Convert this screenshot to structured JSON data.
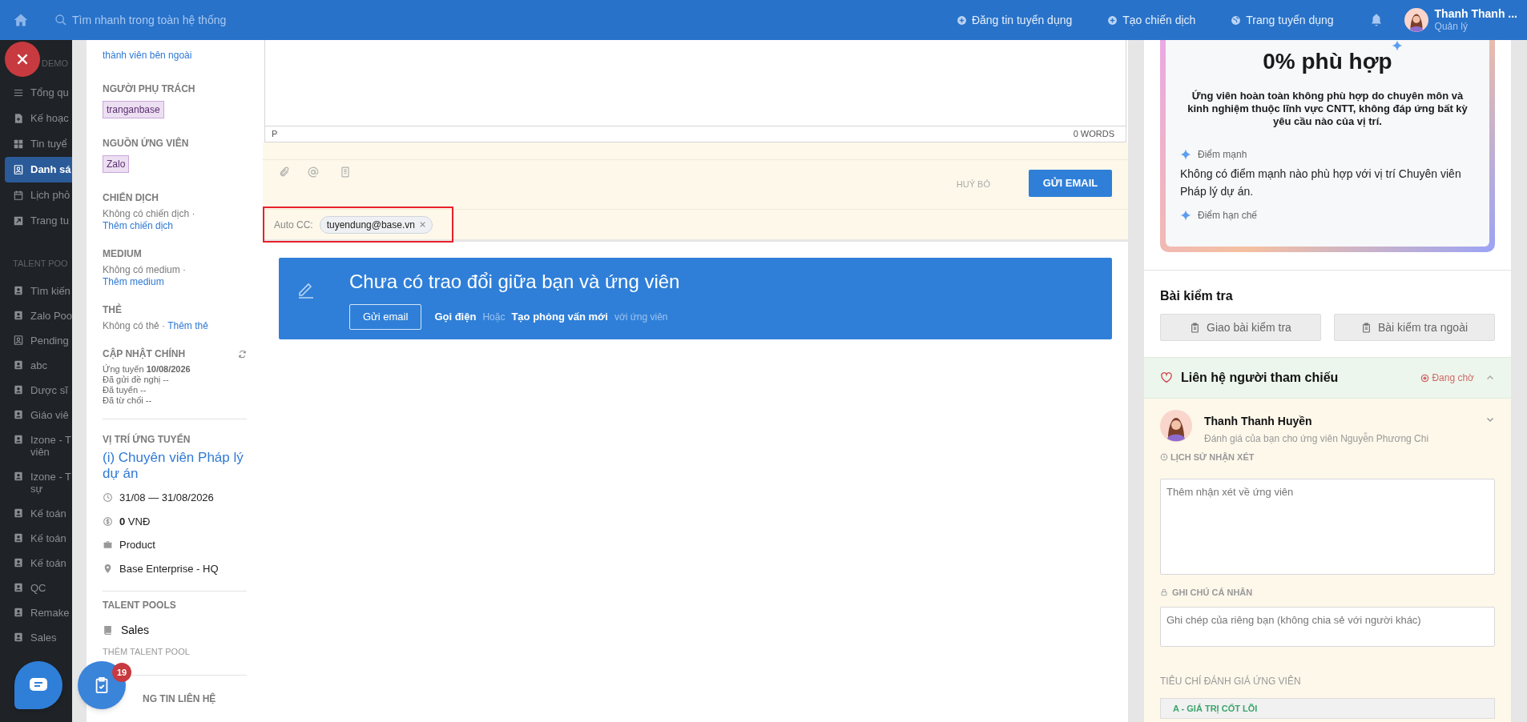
{
  "topbar": {
    "search": {
      "placeholder": "Tìm nhanh trong toàn hệ thống"
    },
    "actions": [
      {
        "label": "Đăng tin tuyển dụng",
        "kind": "plus"
      },
      {
        "label": "Tạo chiến dịch",
        "kind": "plus"
      },
      {
        "label": "Trang tuyển dụng",
        "kind": "globe"
      }
    ],
    "user": {
      "name": "Thanh Thanh ...",
      "role": "Quản lý"
    }
  },
  "sidebar": {
    "heading": "DEMO",
    "items": [
      {
        "label": "Tổng qu",
        "kind": "list",
        "selected": false
      },
      {
        "label": "Kế hoạc",
        "kind": "doc",
        "selected": false
      },
      {
        "label": "Tin tuyể",
        "kind": "grid",
        "selected": false
      },
      {
        "label": "Danh sá",
        "kind": "card",
        "selected": true
      },
      {
        "label": "Lịch phỏ",
        "kind": "calendar",
        "selected": false
      },
      {
        "label": "Trang tu",
        "kind": "external",
        "selected": false
      }
    ],
    "section": "TALENT POO",
    "pools": [
      {
        "label": "Tìm kiến",
        "kind": "person"
      },
      {
        "label": "Zalo Poo",
        "kind": "person"
      },
      {
        "label": "Pending",
        "kind": "outline"
      },
      {
        "label": "abc",
        "kind": "person"
      },
      {
        "label": "Dược sĩ",
        "kind": "person"
      },
      {
        "label": "Giáo viê",
        "kind": "person"
      },
      {
        "label": "Izone - T\nviên",
        "kind": "person"
      },
      {
        "label": "Izone - T\nsự",
        "kind": "person"
      },
      {
        "label": "Kế toán",
        "kind": "person"
      },
      {
        "label": "Kế toán",
        "kind": "person"
      },
      {
        "label": "Kế toán",
        "kind": "person"
      },
      {
        "label": "QC",
        "kind": "person"
      },
      {
        "label": "Remake",
        "kind": "person"
      },
      {
        "label": "Sales",
        "kind": "person"
      }
    ]
  },
  "floating": {
    "tasks_badge": "19"
  },
  "details": {
    "share_link": "thành viên bên ngoài",
    "tags": [
      {
        "label": "NGƯỜI PHỤ TRÁCH",
        "tag": "tranganbase"
      },
      {
        "label": "NGUỒN ỨNG VIÊN",
        "tag": "Zalo"
      }
    ],
    "links": [
      {
        "label": "CHIẾN DỊCH",
        "text": "Không có chiến dịch · ",
        "link": "Thêm chiến dịch"
      },
      {
        "label": "MEDIUM",
        "text": "Không có medium · ",
        "link": "Thêm medium"
      },
      {
        "label": "THẺ",
        "text": "Không có thẻ · ",
        "link": "Thêm thẻ"
      }
    ],
    "updates": {
      "label": "CẬP NHẬT CHÍNH",
      "lines": [
        "Ứng tuyển **10/08/2026**",
        "Đã gửi đề nghị --",
        "Đã tuyển --",
        "Đã từ chối --"
      ]
    },
    "position": {
      "label": "VỊ TRÍ ỨNG TUYỂN",
      "title": "(i) Chuyên viên Pháp lý dự án",
      "details": [
        {
          "kind": "clock",
          "text": "31/08 — 31/08/2026"
        },
        {
          "kind": "money",
          "text": "**0** VNĐ"
        },
        {
          "kind": "briefcase",
          "text": "Product"
        },
        {
          "kind": "pin",
          "text": "Base Enterprise - HQ"
        }
      ]
    },
    "talent_pools": {
      "label": "TALENT POOLS",
      "pools": [
        "Sales"
      ],
      "add": "THÊM TALENT POOL"
    },
    "contact": {
      "label": "NG TIN LIÊN HỆ"
    }
  },
  "composer": {
    "path": "P",
    "word_count": "0 WORDS",
    "cancel": "HUỶ BỎ",
    "send": "GỬI EMAIL",
    "auto_cc": {
      "label": "Auto CC:",
      "chips": [
        "tuyendung@base.vn"
      ],
      "highlighted": true
    }
  },
  "empty_state": {
    "title": "Chưa có trao đổi giữa bạn và ứng viên",
    "button": "Gửi email",
    "call": "Gọi điện",
    "or": "Hoặc",
    "interview": "Tạo phỏng vấn mới",
    "suffix": "với ứng viên"
  },
  "match": {
    "score": "0% phù hợp",
    "summary": "Ứng viên hoàn toàn không phù hợp do chuyên môn và kinh nghiệm thuộc lĩnh vực CNTT, không đáp ứng bất kỳ yêu cầu nào của vị trí.",
    "strengths_label": "Điểm mạnh",
    "strengths": "Không có điểm mạnh nào phù hợp với vị trí Chuyên viên Pháp lý dự án.",
    "weaknesses_label": "Điểm hạn chế"
  },
  "tests": {
    "title": "Bài kiểm tra",
    "buttons": [
      "Giao bài kiểm tra",
      "Bài kiểm tra ngoài"
    ]
  },
  "references": {
    "title": "Liên hệ người tham chiếu",
    "status": "Đang chờ",
    "expanded": true,
    "reviewer": {
      "name": "Thanh Thanh Huyền",
      "subtitle": "Đánh giá của bạn cho ứng viên Nguyễn Phương Chi"
    },
    "history": "LỊCH SỬ NHẬN XÉT",
    "comment_placeholder": "Thêm nhận xét về ứng viên",
    "note_label": "GHI CHÚ CÁ NHÂN",
    "note_placeholder": "Ghi chép của riêng bạn (không chia sẻ với người khác)",
    "criteria_label": "TIÊU CHÍ ĐÁNH GIÁ ỨNG VIÊN",
    "criteria_group": "A - GIÁ TRỊ CỐT LÕI"
  }
}
